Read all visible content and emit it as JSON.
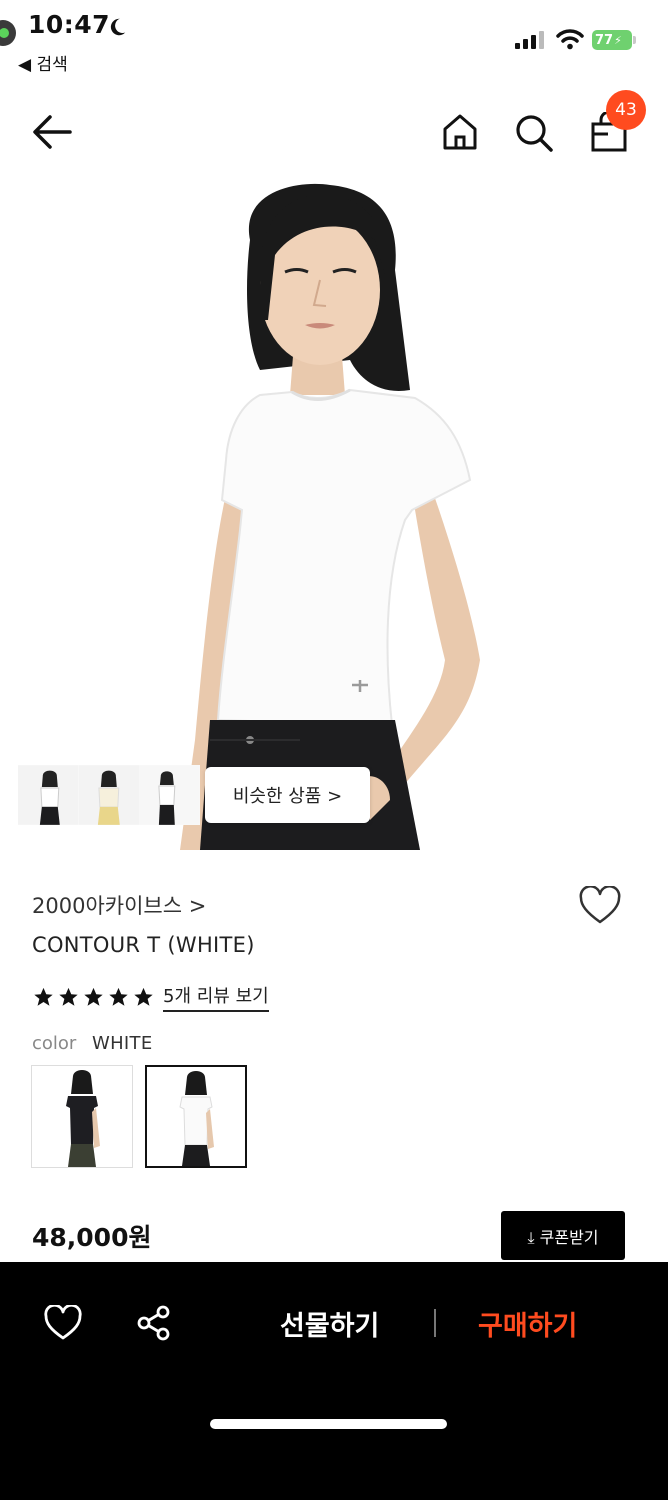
{
  "status": {
    "time": "10:47",
    "back_app": "◀ 검색",
    "battery": "77"
  },
  "nav": {
    "cart_count": "43",
    "icons": [
      "back-arrow-icon",
      "home-icon",
      "search-icon",
      "shopping-bag-icon"
    ]
  },
  "gallery": {
    "similar_label": "비슷한 상품 >",
    "thumbnails": [
      "thumb-black-tee",
      "thumb-ivory-tee",
      "thumb-white-tee"
    ]
  },
  "product": {
    "brand": "2000아카이브스 >",
    "name": "CONTOUR T (WHITE)",
    "rating_stars": 5,
    "review_link": "5개 리뷰 보기",
    "color_label": "color",
    "color_value": "WHITE",
    "swatches": [
      "black",
      "white"
    ],
    "selected_swatch": "white",
    "price": "48,000원",
    "coupon_label": "⤓ 쿠폰받기"
  },
  "bottom_bar": {
    "gift_label": "선물하기",
    "buy_label": "구매하기"
  },
  "colors": {
    "accent": "#ff4b1f",
    "badge": "#ff4b1f",
    "battery": "#6fd16f",
    "bottom_bar": "#000000"
  }
}
